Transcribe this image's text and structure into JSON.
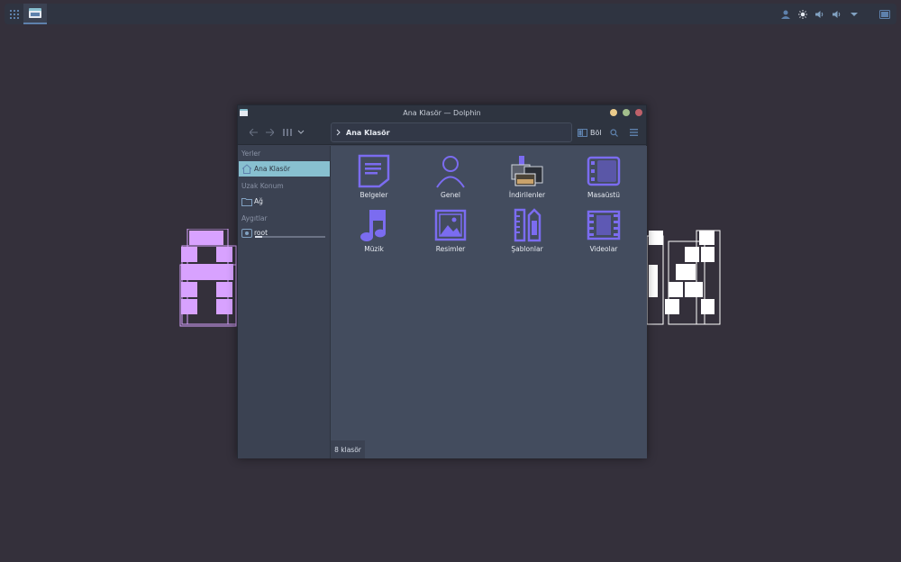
{
  "panel": {
    "launcher_icon": "app-grid-icon",
    "task_icon": "dolphin-folder-icon",
    "tray_icons": [
      "user-icon",
      "brightness-icon",
      "speaker-icon",
      "speaker-icon",
      "chevron-down-icon"
    ],
    "show_desktop_icon": "show-desktop-icon"
  },
  "window": {
    "title": "Ana Klasör — Dolphin",
    "breadcrumb": "Ana Klasör",
    "split_label": "Böl"
  },
  "sidebar": {
    "sections": {
      "places": "Yerler",
      "remote": "Uzak Konum",
      "devices": "Aygıtlar"
    },
    "items": [
      {
        "label": "Ana Klasör",
        "icon": "home-icon",
        "active": true
      },
      {
        "label": "Ağ",
        "icon": "network-folder-icon",
        "active": false
      },
      {
        "label": "root",
        "icon": "drive-icon",
        "active": false
      }
    ],
    "root_usage_fraction": 0.1
  },
  "folders": [
    {
      "label": "Belgeler",
      "icon": "documents-folder-icon"
    },
    {
      "label": "Genel",
      "icon": "public-folder-icon"
    },
    {
      "label": "İndirilenler",
      "icon": "downloads-folder-icon"
    },
    {
      "label": "Masaüstü",
      "icon": "desktop-folder-icon"
    },
    {
      "label": "Müzik",
      "icon": "music-folder-icon"
    },
    {
      "label": "Resimler",
      "icon": "pictures-folder-icon"
    },
    {
      "label": "Şablonlar",
      "icon": "templates-folder-icon"
    },
    {
      "label": "Videolar",
      "icon": "videos-folder-icon"
    }
  ],
  "status": {
    "text": "8 klasör"
  },
  "colors": {
    "desktop_bg": "#34303b",
    "accent_blue": "#5e81ac",
    "selection": "#88c0d0",
    "folder_icon": "#7b6cf0",
    "logo_purple": "#d8a2ff"
  }
}
